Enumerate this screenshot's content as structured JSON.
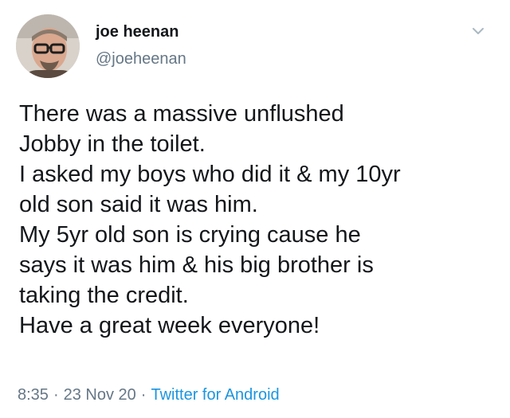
{
  "author": {
    "name": "joe heenan",
    "handle": "@joeheenan"
  },
  "tweet": {
    "lines": [
      "There was a massive unflushed",
      "Jobby in the toilet.",
      "I asked my boys who did it & my 10yr",
      "old son said it was him.",
      "My 5yr old son is crying cause he",
      "says it was him & his big brother is",
      "taking the credit.",
      "Have a great week everyone!"
    ]
  },
  "meta": {
    "time": "8:35",
    "separator": "·",
    "date": "23 Nov 20",
    "client": "Twitter for Android"
  },
  "icons": {
    "avatar": "profile-photo",
    "caret": "chevron-down-icon"
  },
  "colors": {
    "text": "#14171a",
    "secondary": "#657786",
    "link": "#1b95e0"
  }
}
